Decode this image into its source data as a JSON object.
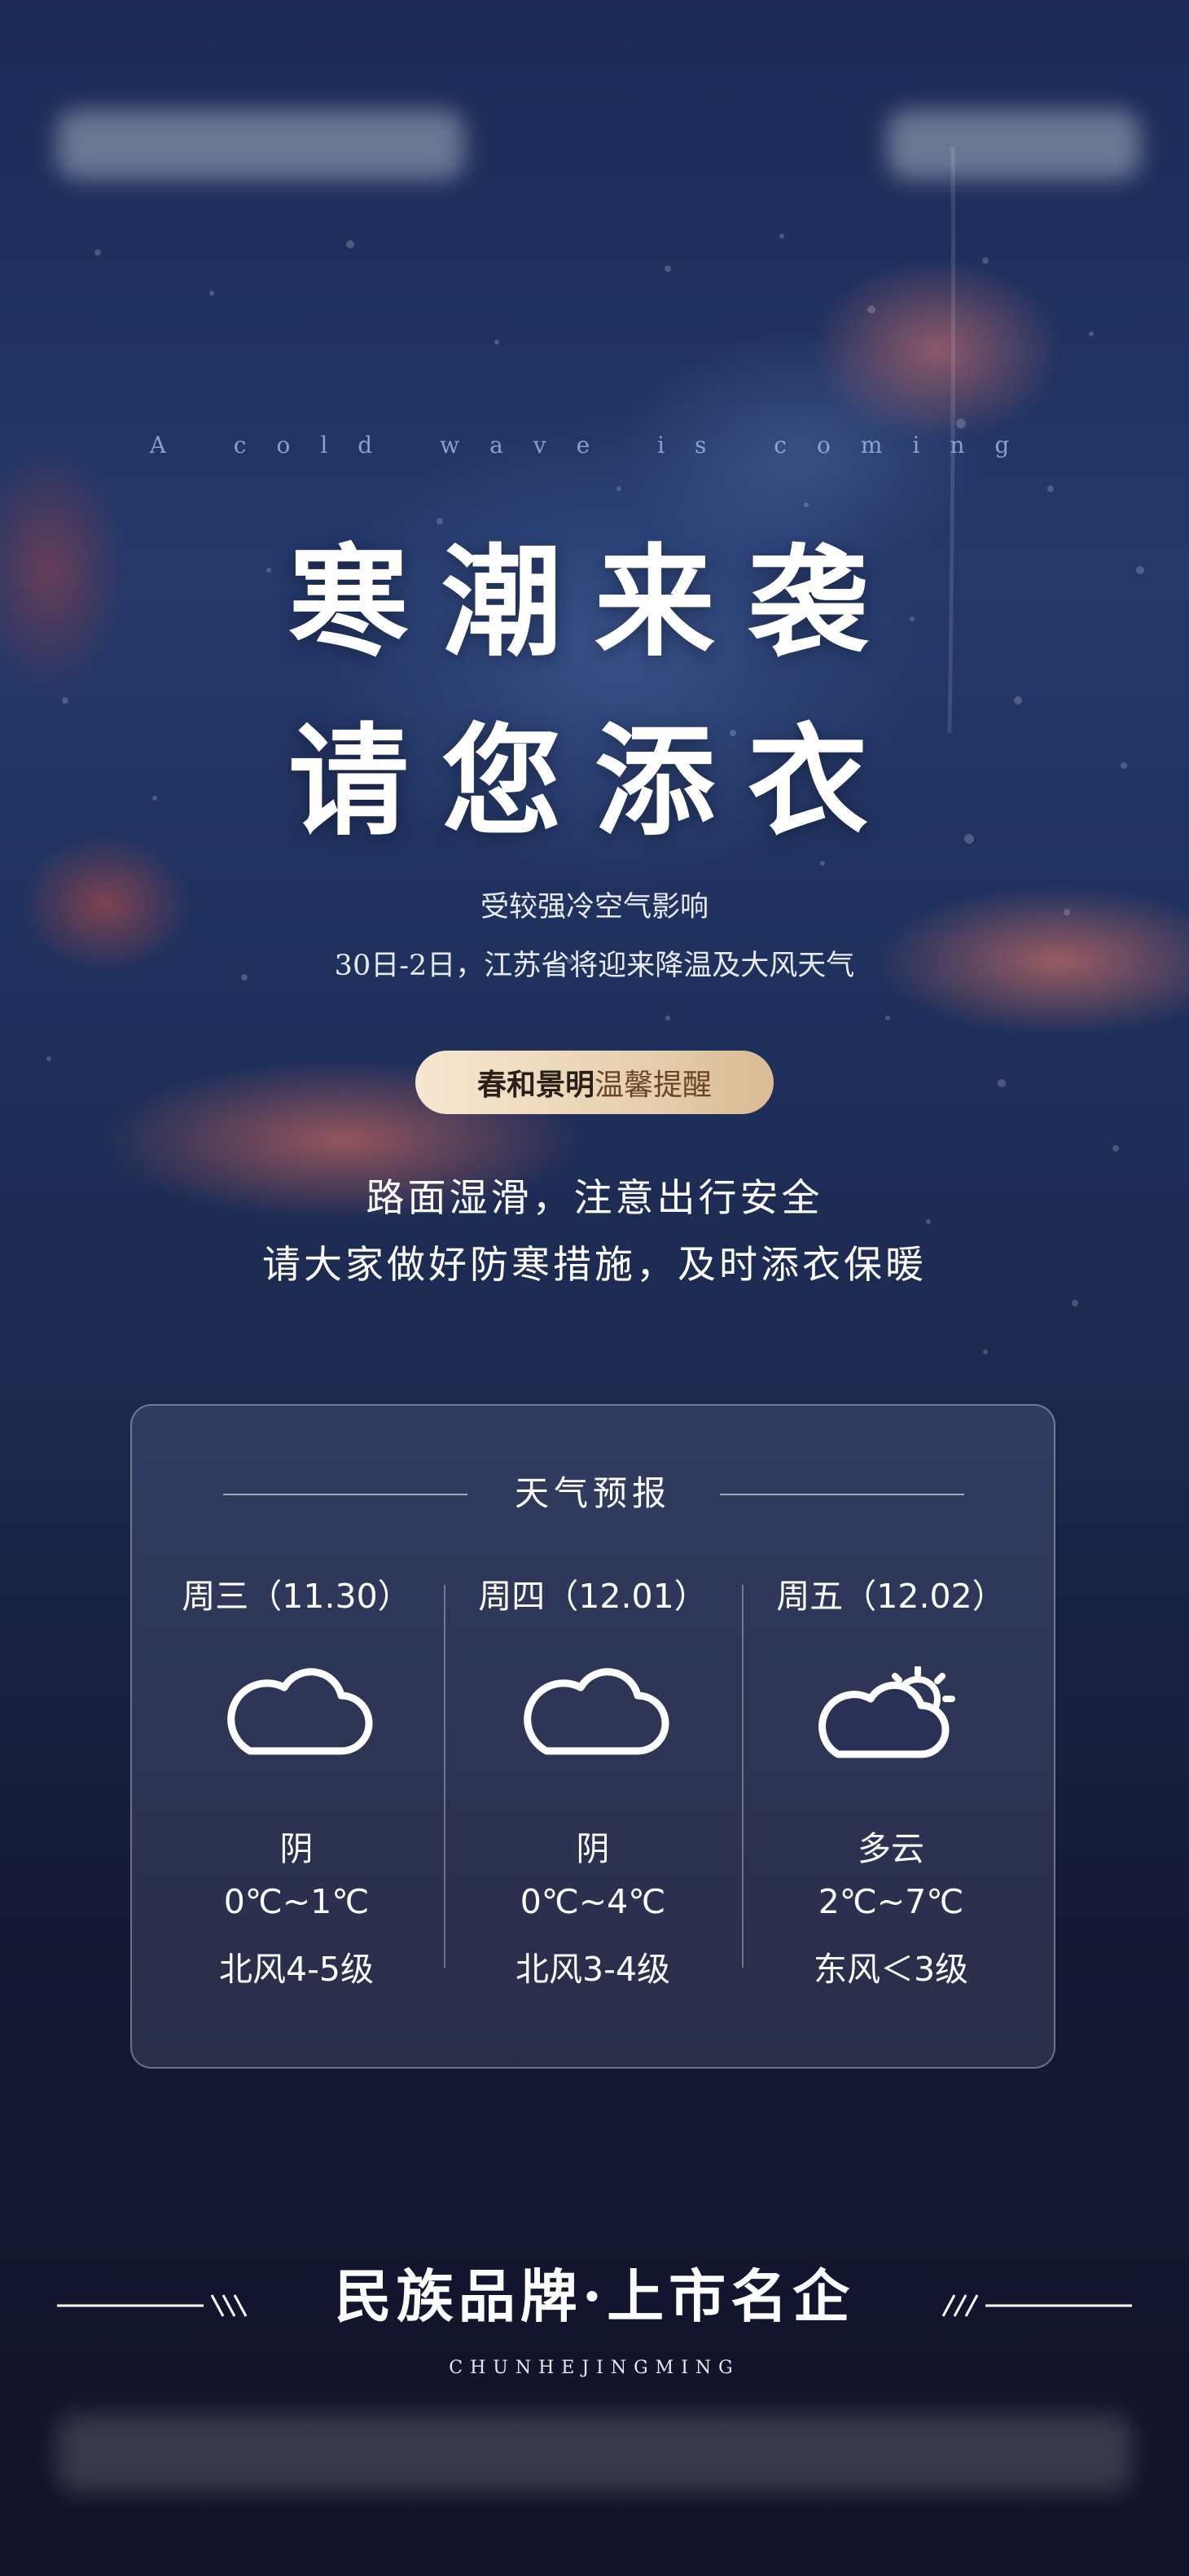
{
  "header": {
    "tagline": "A cold wave is coming",
    "title_line1": "寒潮来袭",
    "title_line2": "请您添衣",
    "subtitle_line1": "受较强冷空气影响",
    "subtitle_line2": "30日-2日，江苏省将迎来降温及大风天气"
  },
  "reminder": {
    "brand": "春和景明",
    "text": "温馨提醒"
  },
  "message": {
    "line1": "路面湿滑，注意出行安全",
    "line2": "请大家做好防寒措施，及时添衣保暖"
  },
  "forecast": {
    "title": "天气预报",
    "days": [
      {
        "day": "周三（11.30）",
        "icon": "cloud-icon",
        "condition": "阴",
        "temp": "0℃~1℃",
        "wind": "北风4-5级"
      },
      {
        "day": "周四（12.01）",
        "icon": "cloud-icon",
        "condition": "阴",
        "temp": "0℃~4℃",
        "wind": "北风3-4级"
      },
      {
        "day": "周五（12.02）",
        "icon": "partly-cloudy-icon",
        "condition": "多云",
        "temp": "2℃~7℃",
        "wind": "东风＜3级"
      }
    ]
  },
  "footer": {
    "title": "民族品牌·上市名企",
    "subtitle": "CHUNHEJINGMING"
  },
  "colors": {
    "pill_gradient_start": "#f7e7d0",
    "pill_gradient_end": "#d9bb94",
    "background_top": "#1c2a55",
    "background_bottom": "#121228",
    "text": "#ffffff"
  }
}
